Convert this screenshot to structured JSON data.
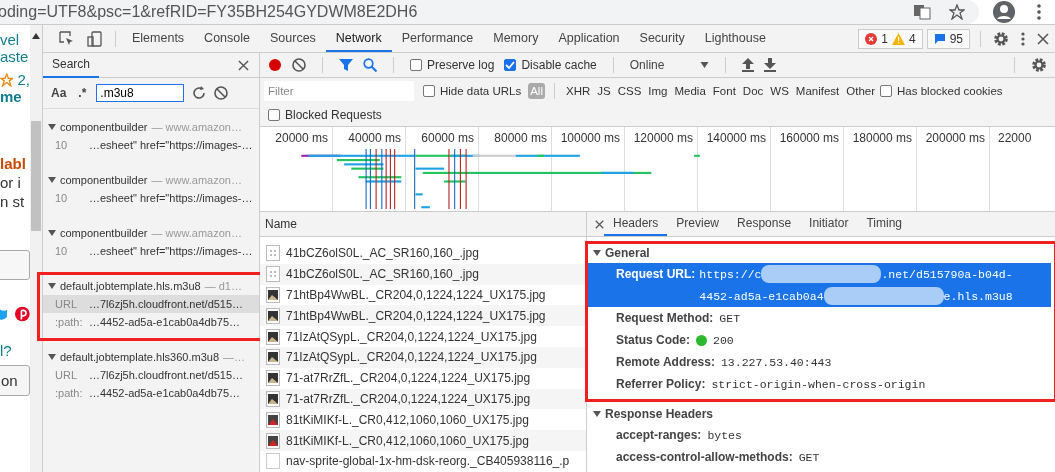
{
  "address_bar": {
    "url": "oding=UTF8&psc=1&refRID=FY35BH254GYDWM8E2DH6"
  },
  "page_fragments": [
    {
      "kind": "link",
      "text": "vel"
    },
    {
      "kind": "link",
      "text": "aste"
    },
    {
      "kind": "rating",
      "text": "2,"
    },
    {
      "kind": "bold-link",
      "text": "me"
    },
    {
      "kind": "alert",
      "text": "labl"
    },
    {
      "kind": "text",
      "text": "or i"
    },
    {
      "kind": "text",
      "text": "n st"
    },
    {
      "kind": "outline-button"
    },
    {
      "kind": "social"
    },
    {
      "kind": "link",
      "text": "l?"
    },
    {
      "kind": "button",
      "text": "on"
    }
  ],
  "devtools_tabs": [
    {
      "label": "Elements",
      "selected": false
    },
    {
      "label": "Console",
      "selected": false
    },
    {
      "label": "Sources",
      "selected": false
    },
    {
      "label": "Network",
      "selected": true
    },
    {
      "label": "Performance",
      "selected": false
    },
    {
      "label": "Memory",
      "selected": false
    },
    {
      "label": "Application",
      "selected": false
    },
    {
      "label": "Security",
      "selected": false
    },
    {
      "label": "Lighthouse",
      "selected": false
    }
  ],
  "counters": {
    "errors": "1",
    "warnings": "4",
    "messages": "95"
  },
  "search_panel": {
    "title": "Search",
    "match_case": "Aa",
    "regex": ".*",
    "query": ".m3u8",
    "results": [
      {
        "file": "componentbuilder",
        "source": "— www.amazon…",
        "outlined": false,
        "lines": [
          {
            "label": "10",
            "text": "…esheet\" href=\"https://images-…",
            "selected": false
          }
        ]
      },
      {
        "file": "componentbuilder",
        "source": "— www.amazon…",
        "outlined": false,
        "lines": [
          {
            "label": "10",
            "text": "…esheet\" href=\"https://images-…",
            "selected": false
          }
        ]
      },
      {
        "file": "componentbuilder",
        "source": "— www.amazon…",
        "outlined": false,
        "lines": [
          {
            "label": "10",
            "text": "…esheet\" href=\"https://images-…",
            "selected": false
          }
        ]
      },
      {
        "file": "default.jobtemplate.hls.m3u8",
        "source": "— d1…",
        "outlined": true,
        "lines": [
          {
            "label": "URL",
            "text": "…7l6zj5h.cloudfront.net/d515…",
            "selected": true
          },
          {
            "label": ":path:",
            "text": "…4452-ad5a-e1cab0a4db75…",
            "selected": false
          }
        ]
      },
      {
        "file": "default.jobtemplate.hls360.m3u8",
        "source": "—…",
        "outlined": false,
        "lines": [
          {
            "label": "URL",
            "text": "…7l6zj5h.cloudfront.net/d515…",
            "selected": false
          },
          {
            "label": ":path:",
            "text": "…4452-ad5a-e1cab0a4db75…",
            "selected": false
          }
        ]
      }
    ]
  },
  "network_toolbar": {
    "recording": true,
    "preserve_log": {
      "label": "Preserve log",
      "checked": false
    },
    "disable_cache": {
      "label": "Disable cache",
      "checked": true
    },
    "throttling": "Online"
  },
  "filter_bar": {
    "placeholder": "Filter",
    "hide_data_urls": {
      "label": "Hide data URLs",
      "checked": false
    },
    "types": [
      {
        "label": "All",
        "selected": true
      },
      {
        "label": "XHR",
        "selected": false
      },
      {
        "label": "JS",
        "selected": false
      },
      {
        "label": "CSS",
        "selected": false
      },
      {
        "label": "Img",
        "selected": false
      },
      {
        "label": "Media",
        "selected": false
      },
      {
        "label": "Font",
        "selected": false
      },
      {
        "label": "Doc",
        "selected": false
      },
      {
        "label": "WS",
        "selected": false
      },
      {
        "label": "Manifest",
        "selected": false
      },
      {
        "label": "Other",
        "selected": false
      }
    ],
    "has_blocked_cookies": {
      "label": "Has blocked cookies",
      "checked": false
    },
    "blocked_requests": {
      "label": "Blocked Requests",
      "checked": false
    }
  },
  "timeline": {
    "ticks": [
      "20000 ms",
      "40000 ms",
      "60000 ms",
      "80000 ms",
      "100000 ms",
      "120000 ms",
      "140000 ms",
      "160000 ms",
      "180000 ms",
      "200000 ms",
      "22000"
    ]
  },
  "requests": {
    "column": "Name",
    "rows": [
      {
        "name": "41bCZ6olS0L._AC_SR160,160_.jpg",
        "kind": "placeholder"
      },
      {
        "name": "41bCZ6olS0L._AC_SR160,160_.jpg",
        "kind": "placeholder"
      },
      {
        "name": "71htBp4WwBL._CR204,0,1224,1224_UX175.jpg",
        "kind": "photo"
      },
      {
        "name": "71htBp4WwBL._CR204,0,1224,1224_UX175.jpg",
        "kind": "photo"
      },
      {
        "name": "71IzAtQSypL._CR204,0,1224,1224_UX175.jpg",
        "kind": "photo"
      },
      {
        "name": "71IzAtQSypL._CR204,0,1224,1224_UX175.jpg",
        "kind": "photo"
      },
      {
        "name": "71-at7RrZfL._CR204,0,1224,1224_UX175.jpg",
        "kind": "photo"
      },
      {
        "name": "71-at7RrZfL._CR204,0,1224,1224_UX175.jpg",
        "kind": "photo"
      },
      {
        "name": "81tKiMIKf-L._CR0,412,1060,1060_UX175.jpg",
        "kind": "red-photo"
      },
      {
        "name": "81tKiMIKf-L._CR0,412,1060,1060_UX175.jpg",
        "kind": "red-photo"
      },
      {
        "name": "nav-sprite-global-1x-hm-dsk-reorg._CB405938116_.p",
        "kind": "blank"
      }
    ]
  },
  "details": {
    "tabs": [
      {
        "label": "Headers",
        "selected": true
      },
      {
        "label": "Preview",
        "selected": false
      },
      {
        "label": "Response",
        "selected": false
      },
      {
        "label": "Initiator",
        "selected": false
      },
      {
        "label": "Timing",
        "selected": false
      }
    ],
    "sections": [
      {
        "title": "General",
        "outlined": true,
        "rows": [
          {
            "kind": "url",
            "name": "Request URL:",
            "selected": true,
            "lines": [
              [
                {
                  "text": "https://c"
                },
                {
                  "redacted": true
                },
                {
                  "text": ".net/d515790a-b04d-"
                }
              ],
              [
                {
                  "text": "4452-ad5a-e1cab0a4"
                },
                {
                  "redacted": true
                },
                {
                  "text": "e.hls.m3u8"
                }
              ]
            ]
          },
          {
            "kind": "plain",
            "name": "Request Method:",
            "value": "GET",
            "selected": false
          },
          {
            "kind": "status",
            "name": "Status Code:",
            "value": "200",
            "selected": false
          },
          {
            "kind": "plain",
            "name": "Remote Address:",
            "value": "13.227.53.40:443",
            "selected": false
          },
          {
            "kind": "plain",
            "name": "Referrer Policy:",
            "value": "strict-origin-when-cross-origin",
            "selected": false
          }
        ]
      },
      {
        "title": "Response Headers",
        "outlined": false,
        "rows": [
          {
            "kind": "plain",
            "name": "accept-ranges:",
            "value": "bytes",
            "selected": false
          },
          {
            "kind": "plain",
            "name": "access-control-allow-methods:",
            "value": "GET",
            "selected": false
          }
        ]
      }
    ]
  }
}
